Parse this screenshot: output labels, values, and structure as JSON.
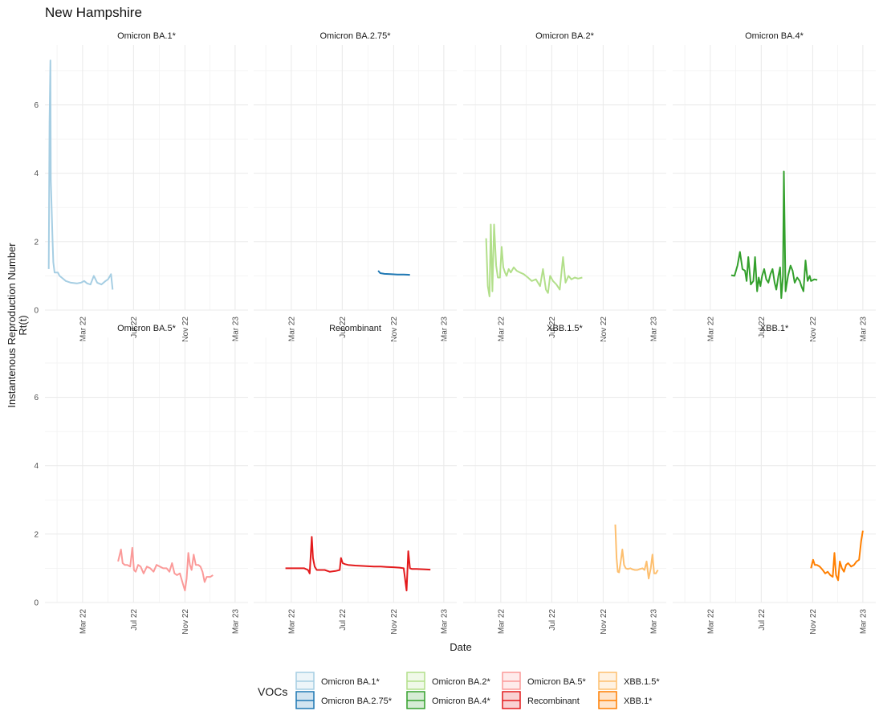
{
  "chart_data": {
    "type": "line",
    "title": "New Hampshire",
    "xlabel": "Date",
    "ylabel": "Instantenous Reproduction Number",
    "ylabel2": "Rt(t)",
    "legend_title": "VOCs",
    "x_ticks": [
      "Mar 22",
      "Jul 22",
      "Nov 22",
      "Mar 23"
    ],
    "x_tick_dates": [
      "2022-03-01",
      "2022-07-01",
      "2022-11-01",
      "2023-03-01"
    ],
    "xlim": [
      "2021-12-01",
      "2023-04-01"
    ],
    "y_ticks": [
      "0",
      "2",
      "4",
      "6"
    ],
    "ylim": [
      0,
      7.75
    ],
    "grid": true,
    "legend_position": "bottom",
    "series": [
      {
        "name": "Omicron BA.1*",
        "color": "#a6cee3",
        "x": [
          "2021-12-10",
          "2021-12-12",
          "2021-12-14",
          "2021-12-15",
          "2021-12-17",
          "2021-12-19",
          "2021-12-21",
          "2021-12-24",
          "2021-12-28",
          "2022-01-01",
          "2022-01-05",
          "2022-01-10",
          "2022-01-20",
          "2022-02-01",
          "2022-02-15",
          "2022-02-25",
          "2022-03-05",
          "2022-03-12",
          "2022-03-20",
          "2022-03-28",
          "2022-04-05",
          "2022-04-15",
          "2022-04-25",
          "2022-05-01",
          "2022-05-08",
          "2022-05-12"
        ],
        "y": [
          1.2,
          5.5,
          7.3,
          3.8,
          3.0,
          2.1,
          1.4,
          1.1,
          1.1,
          1.1,
          1.0,
          0.95,
          0.85,
          0.8,
          0.78,
          0.8,
          0.85,
          0.78,
          0.75,
          1.0,
          0.8,
          0.75,
          0.85,
          0.9,
          1.05,
          0.6
        ]
      },
      {
        "name": "Omicron BA.2.75*",
        "color": "#1f78b4",
        "x": [
          "2022-09-25",
          "2022-09-30",
          "2022-10-10",
          "2022-10-25",
          "2022-11-10",
          "2022-11-25",
          "2022-12-10"
        ],
        "y": [
          1.15,
          1.08,
          1.06,
          1.05,
          1.04,
          1.04,
          1.03
        ]
      },
      {
        "name": "Omicron BA.2*",
        "color": "#b2df8a",
        "x": [
          "2022-01-25",
          "2022-01-29",
          "2022-02-02",
          "2022-02-05",
          "2022-02-09",
          "2022-02-13",
          "2022-02-18",
          "2022-02-22",
          "2022-02-27",
          "2022-03-03",
          "2022-03-07",
          "2022-03-11",
          "2022-03-15",
          "2022-03-20",
          "2022-03-25",
          "2022-04-01",
          "2022-04-08",
          "2022-04-16",
          "2022-04-25",
          "2022-05-05",
          "2022-05-14",
          "2022-05-24",
          "2022-06-03",
          "2022-06-10",
          "2022-06-17",
          "2022-06-22",
          "2022-06-27",
          "2022-07-04",
          "2022-07-12",
          "2022-07-20",
          "2022-07-28",
          "2022-08-03",
          "2022-08-10",
          "2022-08-17",
          "2022-08-25",
          "2022-09-02",
          "2022-09-12"
        ],
        "y": [
          2.1,
          0.7,
          0.4,
          2.5,
          0.55,
          2.5,
          1.3,
          0.95,
          0.95,
          1.85,
          1.25,
          1.1,
          1.0,
          1.2,
          1.1,
          1.25,
          1.15,
          1.1,
          1.05,
          0.95,
          0.85,
          0.9,
          0.7,
          1.2,
          0.6,
          0.5,
          1.0,
          0.85,
          0.75,
          0.6,
          1.55,
          0.8,
          1.0,
          0.9,
          0.95,
          0.92,
          0.95
        ]
      },
      {
        "name": "Omicron BA.4*",
        "color": "#33a02c",
        "x": [
          "2022-04-20",
          "2022-04-28",
          "2022-05-05",
          "2022-05-11",
          "2022-05-17",
          "2022-05-23",
          "2022-05-27",
          "2022-05-31",
          "2022-06-06",
          "2022-06-12",
          "2022-06-16",
          "2022-06-21",
          "2022-06-25",
          "2022-06-29",
          "2022-07-03",
          "2022-07-08",
          "2022-07-13",
          "2022-07-18",
          "2022-07-23",
          "2022-07-28",
          "2022-08-02",
          "2022-08-06",
          "2022-08-11",
          "2022-08-15",
          "2022-08-18",
          "2022-08-22",
          "2022-08-24",
          "2022-08-28",
          "2022-09-03",
          "2022-09-09",
          "2022-09-14",
          "2022-09-19",
          "2022-09-25",
          "2022-10-01",
          "2022-10-05",
          "2022-10-10",
          "2022-10-15",
          "2022-10-20",
          "2022-10-25",
          "2022-10-28",
          "2022-11-05",
          "2022-11-12"
        ],
        "y": [
          1.02,
          1.0,
          1.3,
          1.7,
          1.2,
          1.15,
          0.85,
          1.55,
          0.75,
          0.85,
          1.55,
          0.55,
          0.95,
          0.7,
          1.0,
          1.2,
          0.9,
          0.8,
          1.05,
          1.2,
          0.8,
          0.6,
          1.0,
          1.25,
          0.35,
          1.0,
          4.05,
          0.55,
          1.0,
          1.3,
          1.15,
          0.8,
          0.95,
          0.85,
          0.7,
          0.55,
          1.45,
          0.85,
          1.0,
          0.85,
          0.9,
          0.88
        ]
      },
      {
        "name": "Omicron BA.5*",
        "color": "#fb9a99",
        "x": [
          "2022-05-25",
          "2022-06-01",
          "2022-06-05",
          "2022-06-10",
          "2022-06-16",
          "2022-06-23",
          "2022-06-28",
          "2022-07-02",
          "2022-07-06",
          "2022-07-12",
          "2022-07-18",
          "2022-07-25",
          "2022-08-02",
          "2022-08-10",
          "2022-08-18",
          "2022-08-25",
          "2022-09-02",
          "2022-09-10",
          "2022-09-18",
          "2022-09-25",
          "2022-10-01",
          "2022-10-07",
          "2022-10-13",
          "2022-10-20",
          "2022-10-27",
          "2022-11-01",
          "2022-11-05",
          "2022-11-09",
          "2022-11-13",
          "2022-11-17",
          "2022-11-22",
          "2022-11-27",
          "2022-12-03",
          "2022-12-08",
          "2022-12-13",
          "2022-12-18",
          "2022-12-23",
          "2023-01-01",
          "2023-01-07"
        ],
        "y": [
          1.2,
          1.55,
          1.15,
          1.1,
          1.1,
          1.05,
          1.6,
          0.95,
          0.9,
          1.1,
          1.05,
          0.85,
          1.05,
          1.0,
          0.9,
          1.1,
          1.05,
          1.0,
          1.0,
          0.9,
          1.15,
          0.85,
          0.8,
          0.85,
          0.55,
          0.35,
          0.7,
          1.45,
          1.1,
          0.95,
          1.4,
          1.1,
          1.1,
          1.05,
          0.9,
          0.6,
          0.75,
          0.75,
          0.8
        ]
      },
      {
        "name": "Recombinant",
        "color": "#e31a1c",
        "x": [
          "2022-02-15",
          "2022-03-01",
          "2022-03-15",
          "2022-04-01",
          "2022-04-10",
          "2022-04-14",
          "2022-04-19",
          "2022-04-22",
          "2022-04-26",
          "2022-05-01",
          "2022-05-10",
          "2022-05-20",
          "2022-06-01",
          "2022-06-15",
          "2022-06-25",
          "2022-06-28",
          "2022-07-02",
          "2022-07-08",
          "2022-07-15",
          "2022-08-01",
          "2022-08-15",
          "2022-09-01",
          "2022-09-15",
          "2022-10-01",
          "2022-10-15",
          "2022-11-01",
          "2022-11-15",
          "2022-11-25",
          "2022-12-02",
          "2022-12-06",
          "2022-12-10",
          "2022-12-15",
          "2022-12-25",
          "2023-01-15",
          "2023-01-28"
        ],
        "y": [
          1.0,
          1.0,
          1.0,
          1.0,
          0.95,
          0.85,
          1.92,
          1.3,
          1.05,
          0.95,
          0.95,
          0.95,
          0.9,
          0.92,
          0.95,
          1.3,
          1.15,
          1.12,
          1.1,
          1.08,
          1.07,
          1.06,
          1.05,
          1.05,
          1.04,
          1.03,
          1.02,
          1.0,
          0.35,
          1.5,
          1.0,
          0.98,
          0.98,
          0.97,
          0.96
        ]
      },
      {
        "name": "XBB.1.5*",
        "color": "#fdbf6f",
        "x": [
          "2022-11-30",
          "2022-12-03",
          "2022-12-06",
          "2022-12-09",
          "2022-12-13",
          "2022-12-17",
          "2022-12-21",
          "2022-12-25",
          "2022-12-30",
          "2023-01-05",
          "2023-01-10",
          "2023-01-16",
          "2023-01-22",
          "2023-01-28",
          "2023-02-03",
          "2023-02-08",
          "2023-02-13",
          "2023-02-18",
          "2023-02-23",
          "2023-02-27",
          "2023-03-03",
          "2023-03-07",
          "2023-03-12"
        ],
        "y": [
          2.28,
          1.3,
          0.9,
          0.88,
          1.2,
          1.55,
          1.1,
          1.0,
          0.98,
          1.0,
          0.97,
          0.95,
          0.95,
          0.98,
          1.0,
          0.95,
          1.2,
          0.7,
          1.0,
          1.4,
          0.85,
          0.85,
          0.95
        ]
      },
      {
        "name": "XBB.1*",
        "color": "#ff7f00",
        "x": [
          "2022-10-28",
          "2022-11-02",
          "2022-11-06",
          "2022-11-11",
          "2022-11-18",
          "2022-11-25",
          "2022-12-01",
          "2022-12-07",
          "2022-12-13",
          "2022-12-19",
          "2022-12-23",
          "2022-12-27",
          "2023-01-01",
          "2023-01-05",
          "2023-01-10",
          "2023-01-15",
          "2023-01-20",
          "2023-01-25",
          "2023-02-01",
          "2023-02-08",
          "2023-02-14",
          "2023-02-20",
          "2023-02-25",
          "2023-03-01"
        ],
        "y": [
          1.0,
          1.25,
          1.1,
          1.1,
          1.05,
          0.95,
          0.85,
          0.9,
          0.8,
          0.75,
          1.45,
          0.8,
          0.65,
          1.2,
          1.0,
          0.9,
          1.1,
          1.15,
          1.05,
          1.1,
          1.2,
          1.25,
          1.8,
          2.1
        ]
      }
    ],
    "panels": [
      "Omicron BA.1*",
      "Omicron BA.2.75*",
      "Omicron BA.2*",
      "Omicron BA.4*",
      "Omicron BA.5*",
      "Recombinant",
      "XBB.1.5*",
      "XBB.1*"
    ]
  }
}
